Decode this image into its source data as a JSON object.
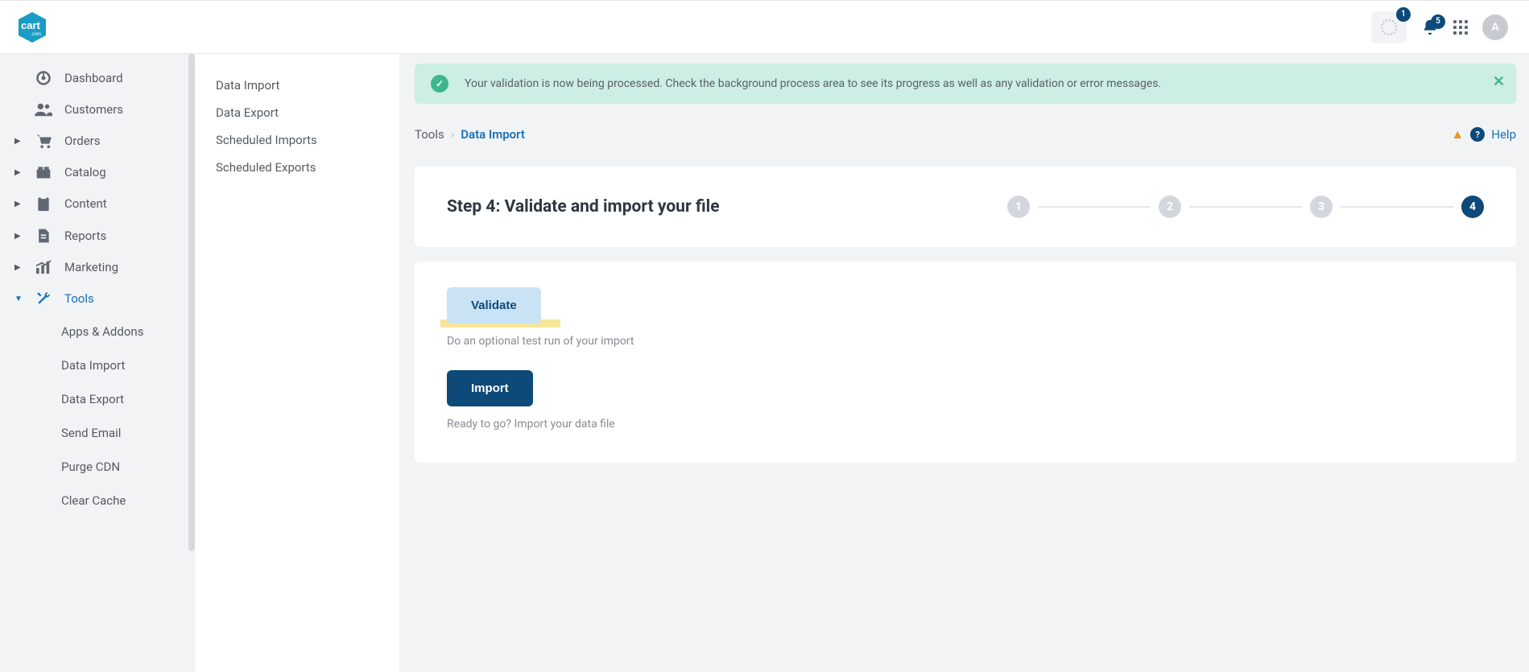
{
  "header": {
    "logo_text": "cart",
    "logo_sub": ".com",
    "process_badge": "1",
    "notif_badge": "5",
    "avatar_initial": "A"
  },
  "primary_nav": {
    "items": [
      {
        "label": "Dashboard"
      },
      {
        "label": "Customers"
      },
      {
        "label": "Orders"
      },
      {
        "label": "Catalog"
      },
      {
        "label": "Content"
      },
      {
        "label": "Reports"
      },
      {
        "label": "Marketing"
      },
      {
        "label": "Tools"
      }
    ],
    "tools_sub": [
      {
        "label": "Apps & Addons"
      },
      {
        "label": "Data Import"
      },
      {
        "label": "Data Export"
      },
      {
        "label": "Send Email"
      },
      {
        "label": "Purge CDN"
      },
      {
        "label": "Clear Cache"
      }
    ]
  },
  "secondary_nav": {
    "items": [
      {
        "label": "Data Import"
      },
      {
        "label": "Data Export"
      },
      {
        "label": "Scheduled Imports"
      },
      {
        "label": "Scheduled Exports"
      }
    ]
  },
  "alert": {
    "text": "Your validation is now being processed. Check the background process area to see its progress as well as any validation or error messages."
  },
  "breadcrumb": {
    "parent": "Tools",
    "separator": "›",
    "current": "Data Import"
  },
  "help": {
    "label": "Help"
  },
  "step": {
    "title": "Step 4: Validate and import your file",
    "stepper": {
      "labels": [
        "1",
        "2",
        "3",
        "4"
      ],
      "active_index": 3
    }
  },
  "actions": {
    "validate_label": "Validate",
    "validate_desc": "Do an optional test run of your import",
    "import_label": "Import",
    "import_desc": "Ready to go? Import your data file"
  }
}
